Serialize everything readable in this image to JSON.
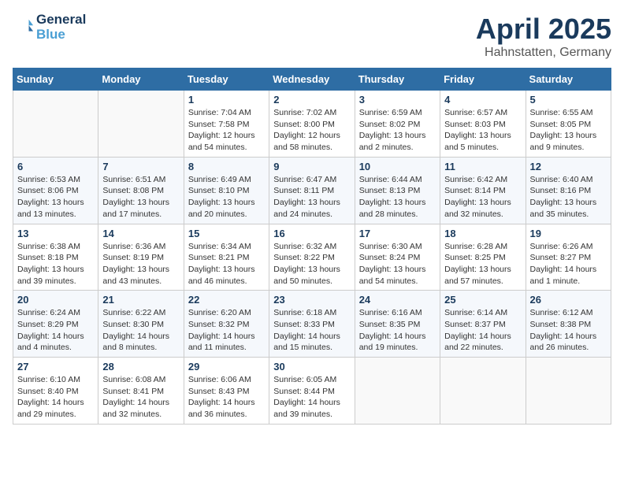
{
  "header": {
    "logo_line1": "General",
    "logo_line2": "Blue",
    "month": "April 2025",
    "location": "Hahnstatten, Germany"
  },
  "weekdays": [
    "Sunday",
    "Monday",
    "Tuesday",
    "Wednesday",
    "Thursday",
    "Friday",
    "Saturday"
  ],
  "weeks": [
    [
      {
        "day": "",
        "info": ""
      },
      {
        "day": "",
        "info": ""
      },
      {
        "day": "1",
        "info": "Sunrise: 7:04 AM\nSunset: 7:58 PM\nDaylight: 12 hours and 54 minutes."
      },
      {
        "day": "2",
        "info": "Sunrise: 7:02 AM\nSunset: 8:00 PM\nDaylight: 12 hours and 58 minutes."
      },
      {
        "day": "3",
        "info": "Sunrise: 6:59 AM\nSunset: 8:02 PM\nDaylight: 13 hours and 2 minutes."
      },
      {
        "day": "4",
        "info": "Sunrise: 6:57 AM\nSunset: 8:03 PM\nDaylight: 13 hours and 5 minutes."
      },
      {
        "day": "5",
        "info": "Sunrise: 6:55 AM\nSunset: 8:05 PM\nDaylight: 13 hours and 9 minutes."
      }
    ],
    [
      {
        "day": "6",
        "info": "Sunrise: 6:53 AM\nSunset: 8:06 PM\nDaylight: 13 hours and 13 minutes."
      },
      {
        "day": "7",
        "info": "Sunrise: 6:51 AM\nSunset: 8:08 PM\nDaylight: 13 hours and 17 minutes."
      },
      {
        "day": "8",
        "info": "Sunrise: 6:49 AM\nSunset: 8:10 PM\nDaylight: 13 hours and 20 minutes."
      },
      {
        "day": "9",
        "info": "Sunrise: 6:47 AM\nSunset: 8:11 PM\nDaylight: 13 hours and 24 minutes."
      },
      {
        "day": "10",
        "info": "Sunrise: 6:44 AM\nSunset: 8:13 PM\nDaylight: 13 hours and 28 minutes."
      },
      {
        "day": "11",
        "info": "Sunrise: 6:42 AM\nSunset: 8:14 PM\nDaylight: 13 hours and 32 minutes."
      },
      {
        "day": "12",
        "info": "Sunrise: 6:40 AM\nSunset: 8:16 PM\nDaylight: 13 hours and 35 minutes."
      }
    ],
    [
      {
        "day": "13",
        "info": "Sunrise: 6:38 AM\nSunset: 8:18 PM\nDaylight: 13 hours and 39 minutes."
      },
      {
        "day": "14",
        "info": "Sunrise: 6:36 AM\nSunset: 8:19 PM\nDaylight: 13 hours and 43 minutes."
      },
      {
        "day": "15",
        "info": "Sunrise: 6:34 AM\nSunset: 8:21 PM\nDaylight: 13 hours and 46 minutes."
      },
      {
        "day": "16",
        "info": "Sunrise: 6:32 AM\nSunset: 8:22 PM\nDaylight: 13 hours and 50 minutes."
      },
      {
        "day": "17",
        "info": "Sunrise: 6:30 AM\nSunset: 8:24 PM\nDaylight: 13 hours and 54 minutes."
      },
      {
        "day": "18",
        "info": "Sunrise: 6:28 AM\nSunset: 8:25 PM\nDaylight: 13 hours and 57 minutes."
      },
      {
        "day": "19",
        "info": "Sunrise: 6:26 AM\nSunset: 8:27 PM\nDaylight: 14 hours and 1 minute."
      }
    ],
    [
      {
        "day": "20",
        "info": "Sunrise: 6:24 AM\nSunset: 8:29 PM\nDaylight: 14 hours and 4 minutes."
      },
      {
        "day": "21",
        "info": "Sunrise: 6:22 AM\nSunset: 8:30 PM\nDaylight: 14 hours and 8 minutes."
      },
      {
        "day": "22",
        "info": "Sunrise: 6:20 AM\nSunset: 8:32 PM\nDaylight: 14 hours and 11 minutes."
      },
      {
        "day": "23",
        "info": "Sunrise: 6:18 AM\nSunset: 8:33 PM\nDaylight: 14 hours and 15 minutes."
      },
      {
        "day": "24",
        "info": "Sunrise: 6:16 AM\nSunset: 8:35 PM\nDaylight: 14 hours and 19 minutes."
      },
      {
        "day": "25",
        "info": "Sunrise: 6:14 AM\nSunset: 8:37 PM\nDaylight: 14 hours and 22 minutes."
      },
      {
        "day": "26",
        "info": "Sunrise: 6:12 AM\nSunset: 8:38 PM\nDaylight: 14 hours and 26 minutes."
      }
    ],
    [
      {
        "day": "27",
        "info": "Sunrise: 6:10 AM\nSunset: 8:40 PM\nDaylight: 14 hours and 29 minutes."
      },
      {
        "day": "28",
        "info": "Sunrise: 6:08 AM\nSunset: 8:41 PM\nDaylight: 14 hours and 32 minutes."
      },
      {
        "day": "29",
        "info": "Sunrise: 6:06 AM\nSunset: 8:43 PM\nDaylight: 14 hours and 36 minutes."
      },
      {
        "day": "30",
        "info": "Sunrise: 6:05 AM\nSunset: 8:44 PM\nDaylight: 14 hours and 39 minutes."
      },
      {
        "day": "",
        "info": ""
      },
      {
        "day": "",
        "info": ""
      },
      {
        "day": "",
        "info": ""
      }
    ]
  ]
}
